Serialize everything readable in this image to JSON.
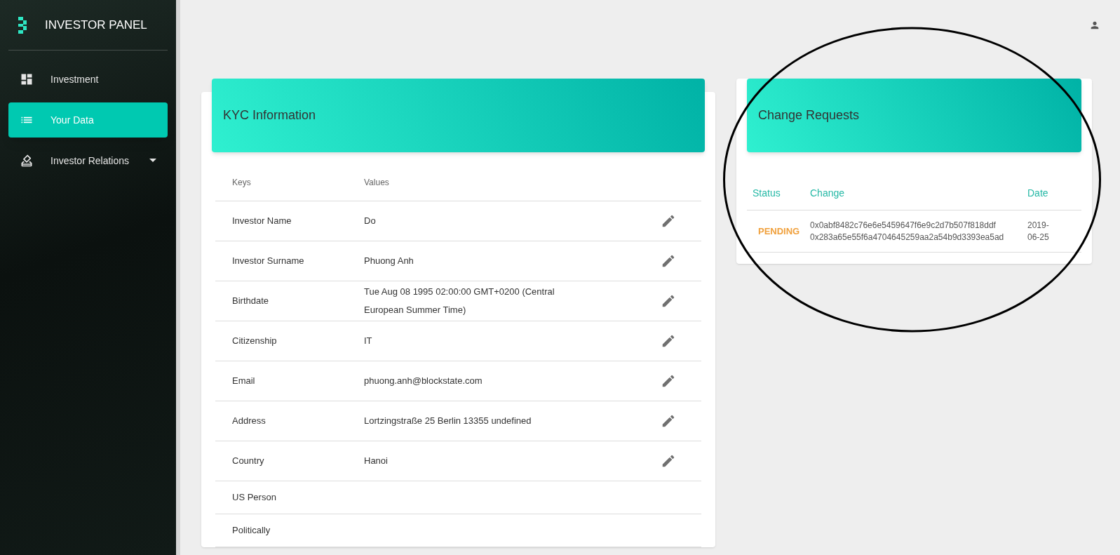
{
  "sidebar": {
    "brand": "INVESTOR PANEL",
    "items": [
      {
        "label": "Investment",
        "selected": false,
        "has_caret": false
      },
      {
        "label": "Your Data",
        "selected": true,
        "has_caret": false
      },
      {
        "label": "Investor Relations",
        "selected": false,
        "has_caret": true
      }
    ]
  },
  "kyc": {
    "title": "KYC Information",
    "columns": [
      "Keys",
      "Values"
    ],
    "rows": [
      {
        "key": "Investor Name",
        "value": "Do",
        "editable": true
      },
      {
        "key": "Investor Surname",
        "value": "Phuong Anh",
        "editable": true
      },
      {
        "key": "Birthdate",
        "value": "Tue Aug 08 1995 02:00:00 GMT+0200 (Central European Summer Time)",
        "editable": true
      },
      {
        "key": "Citizenship",
        "value": "IT",
        "editable": true
      },
      {
        "key": "Email",
        "value": "phuong.anh@blockstate.com",
        "editable": true
      },
      {
        "key": "Address",
        "value": "Lortzingstraße 25 Berlin 13355 undefined",
        "editable": true
      },
      {
        "key": "Country",
        "value": "Hanoi",
        "editable": true
      },
      {
        "key": "US Person",
        "editable": false
      },
      {
        "key": "Politically",
        "editable": false
      }
    ]
  },
  "change_requests": {
    "title": "Change Requests",
    "columns": [
      "Status",
      "Change",
      "Date"
    ],
    "rows": [
      {
        "status": "PENDING",
        "changes": [
          "0x0abf8482c76e6e5459647f6e9c2d7b507f818ddf",
          "0x283a65e55f6a4704645259aa2a54b9d3393ea5ad"
        ],
        "date": "2019-06-25"
      }
    ]
  }
}
